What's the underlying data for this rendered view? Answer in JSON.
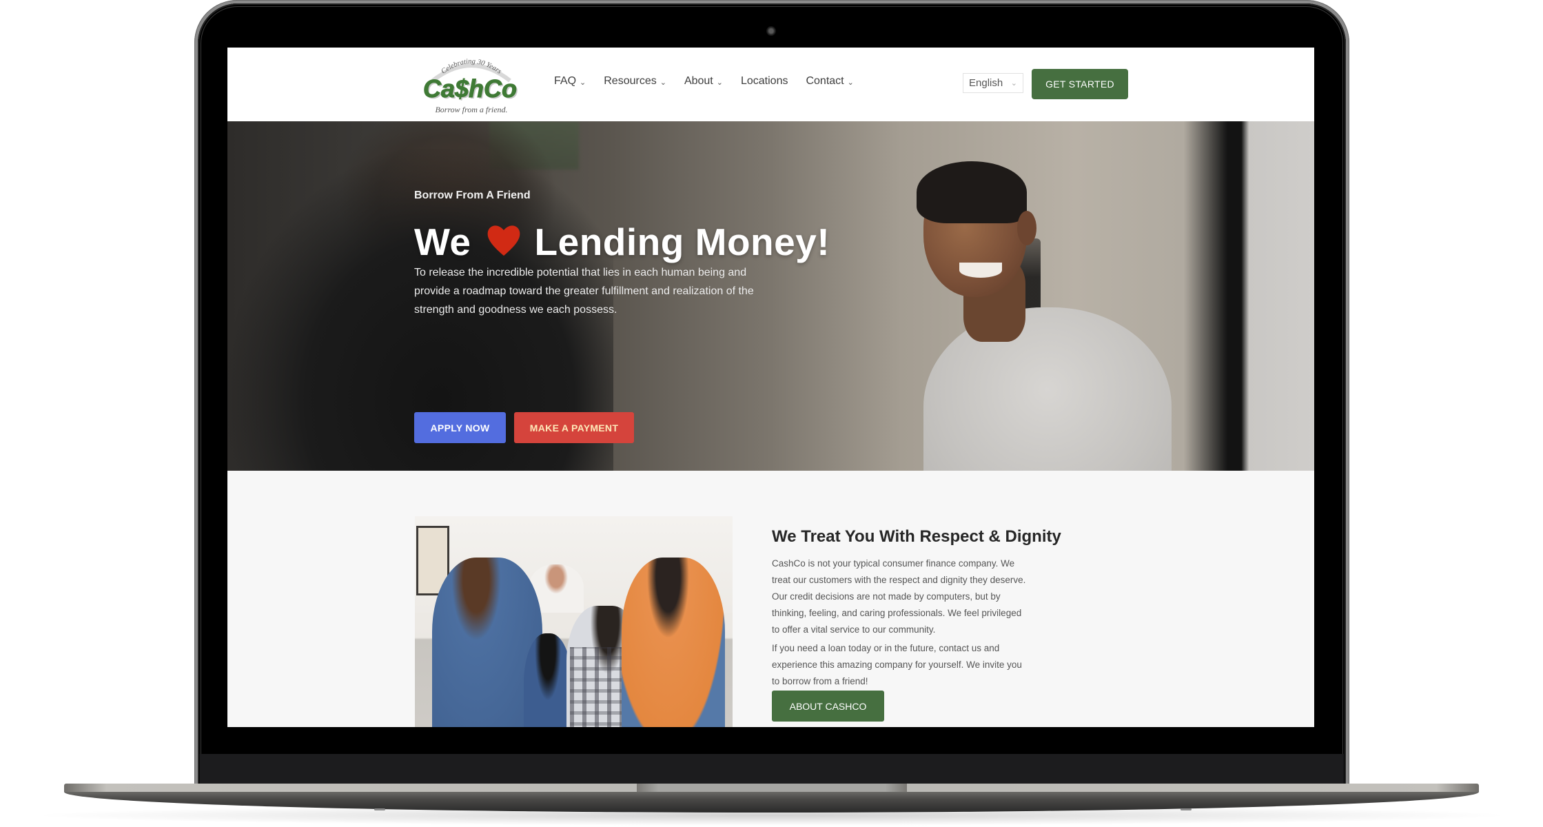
{
  "header": {
    "logo": {
      "arc_text": "Celebrating 30 Years",
      "wordmark": "Ca$hCo",
      "tagline": "Borrow from a friend.",
      "brand_color": "#3f7a35"
    },
    "nav": [
      {
        "label": "FAQ",
        "has_dropdown": true
      },
      {
        "label": "Resources",
        "has_dropdown": true
      },
      {
        "label": "About",
        "has_dropdown": true
      },
      {
        "label": "Locations",
        "has_dropdown": false
      },
      {
        "label": "Contact",
        "has_dropdown": true
      }
    ],
    "language_select": {
      "value": "English"
    },
    "cta_label": "GET STARTED",
    "cta_color": "#466f40"
  },
  "hero": {
    "kicker": "Borrow From A Friend",
    "title_before": "We",
    "title_icon": "heart-icon",
    "title_after": "Lending Money!",
    "description": "To release the incredible potential that lies in each human being and provide a roadmap toward the greater fulfillment and realization of the strength and goodness we each possess.",
    "buttons": [
      {
        "label": "APPLY NOW",
        "color": "#536ddf"
      },
      {
        "label": "MAKE A PAYMENT",
        "color": "#d5443c"
      }
    ]
  },
  "about": {
    "title": "We Treat You With Respect & Dignity",
    "paragraph_1": "CashCo is not your typical consumer finance company. We treat our customers with the respect and dignity they deserve. Our credit decisions are not made by computers, but by thinking, feeling, and caring professionals. We feel privileged to offer a vital service to our community.",
    "paragraph_2": "If you need a loan today or in the future, contact us and experience this amazing company for yourself. We invite you to borrow from a friend!",
    "button_label": "ABOUT CASHCO"
  }
}
